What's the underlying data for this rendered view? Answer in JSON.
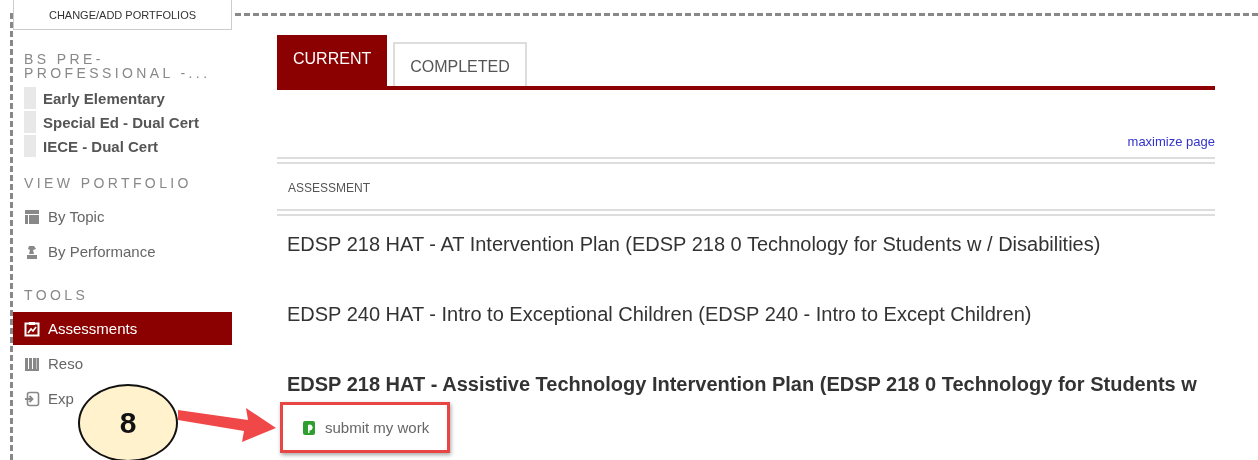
{
  "sidebar": {
    "portfolio_button": "CHANGE/ADD PORTFOLIOS",
    "sections": [
      {
        "kind": "programs",
        "heading": "BS PRE-PROFESSIONAL -...",
        "items": [
          {
            "label": "Early Elementary"
          },
          {
            "label": "Special Ed - Dual Cert"
          },
          {
            "label": "IECE - Dual Cert"
          }
        ]
      },
      {
        "kind": "links",
        "heading": "VIEW PORTFOLIO",
        "items": [
          {
            "label": "By Topic",
            "selected": false
          },
          {
            "label": "By Performance",
            "selected": false
          }
        ]
      },
      {
        "kind": "links",
        "heading": "TOOLS",
        "items": [
          {
            "label": "Assessments",
            "selected": true
          },
          {
            "label": "Reso",
            "selected": false
          },
          {
            "label": "Exp",
            "selected": false
          }
        ]
      }
    ]
  },
  "tabs": [
    {
      "label": "CURRENT",
      "selected": true
    },
    {
      "label": "COMPLETED",
      "selected": false
    }
  ],
  "maximize_link": "maximize page",
  "table": {
    "columns": [
      "ASSESSMENT"
    ],
    "rows": [
      {
        "title": "EDSP 218 HAT - AT Intervention Plan (EDSP 218 0 Technology for Students w / Disabilities)",
        "bold": false
      },
      {
        "title": "EDSP 240 HAT - Intro to Exceptional Children (EDSP 240 - Intro to Except Children)",
        "bold": false
      },
      {
        "title": "EDSP 218 HAT - Assistive Technology Intervention Plan (EDSP 218 0 Technology for Students w",
        "bold": true,
        "action": {
          "label": "submit my work",
          "highlighted": true
        }
      }
    ]
  },
  "callout": {
    "label": "8"
  }
}
